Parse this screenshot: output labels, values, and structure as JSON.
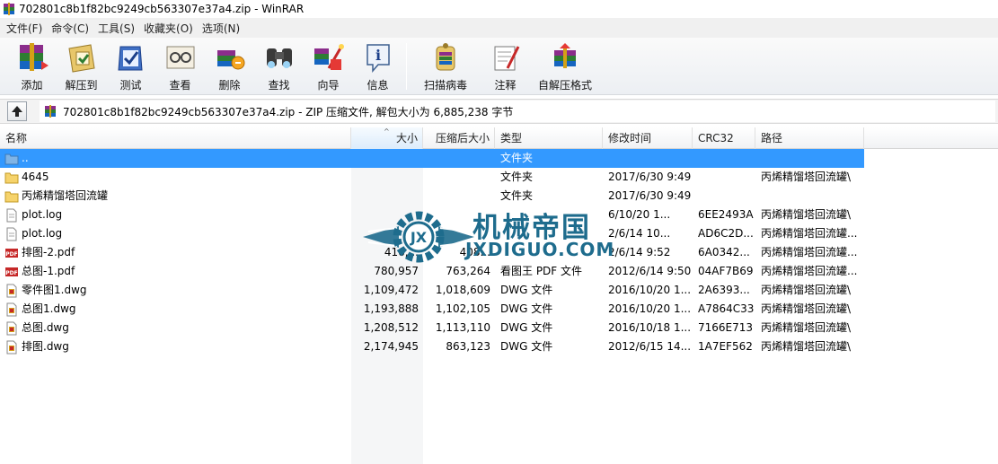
{
  "window": {
    "title": "702801c8b1f82bc9249cb563307e37a4.zip - WinRAR"
  },
  "menu": [
    {
      "label": "文件(F)"
    },
    {
      "label": "命令(C)"
    },
    {
      "label": "工具(S)"
    },
    {
      "label": "收藏夹(O)"
    },
    {
      "label": "选项(N)"
    }
  ],
  "toolbar": [
    {
      "label": "添加",
      "icon": "add-icon"
    },
    {
      "label": "解压到",
      "icon": "extract-to-icon"
    },
    {
      "label": "测试",
      "icon": "test-icon"
    },
    {
      "label": "查看",
      "icon": "view-icon"
    },
    {
      "label": "删除",
      "icon": "delete-icon"
    },
    {
      "label": "查找",
      "icon": "find-icon"
    },
    {
      "label": "向导",
      "icon": "wizard-icon"
    },
    {
      "label": "信息",
      "icon": "info-icon"
    },
    {
      "label": "扫描病毒",
      "icon": "virus-scan-icon"
    },
    {
      "label": "注释",
      "icon": "comment-icon"
    },
    {
      "label": "自解压格式",
      "icon": "sfx-icon"
    }
  ],
  "pathbar": {
    "path": "702801c8b1f82bc9249cb563307e37a4.zip - ZIP 压缩文件, 解包大小为 6,885,238 字节"
  },
  "columns": {
    "name": "名称",
    "size": "大小",
    "packed": "压缩后大小",
    "type": "类型",
    "modified": "修改时间",
    "crc": "CRC32",
    "path": "路径"
  },
  "files": [
    {
      "name": "..",
      "size": "",
      "packed": "",
      "type": "文件夹",
      "modified": "",
      "crc": "",
      "path": "",
      "icon": "folder-up-icon",
      "selected": true
    },
    {
      "name": "4645",
      "size": "",
      "packed": "",
      "type": "文件夹",
      "modified": "2017/6/30 9:49",
      "crc": "",
      "path": "丙烯精馏塔回流罐\\",
      "icon": "folder-icon"
    },
    {
      "name": "丙烯精馏塔回流罐",
      "size": "",
      "packed": "",
      "type": "文件夹",
      "modified": "2017/6/30 9:49",
      "crc": "",
      "path": "",
      "icon": "folder-icon"
    },
    {
      "name": "plot.log",
      "size": "",
      "packed": "",
      "type": "",
      "modified": "6/10/20 1...",
      "crc": "6EE2493A",
      "path": "丙烯精馏塔回流罐\\",
      "icon": "text-file-icon"
    },
    {
      "name": "plot.log",
      "size": "",
      "packed": "",
      "type": "",
      "modified": "2/6/14 10...",
      "crc": "AD6C2D...",
      "path": "丙烯精馏塔回流罐...",
      "icon": "text-file-icon"
    },
    {
      "name": "排图-2.pdf",
      "size": "416,...",
      "packed": "408...",
      "type": "",
      "modified": "2/6/14 9:52",
      "crc": "6A0342...",
      "path": "丙烯精馏塔回流罐...",
      "icon": "pdf-icon"
    },
    {
      "name": "总图-1.pdf",
      "size": "780,957",
      "packed": "763,264",
      "type": "看图王 PDF 文件",
      "modified": "2012/6/14 9:50",
      "crc": "04AF7B69",
      "path": "丙烯精馏塔回流罐...",
      "icon": "pdf-icon"
    },
    {
      "name": "零件图1.dwg",
      "size": "1,109,472",
      "packed": "1,018,609",
      "type": "DWG 文件",
      "modified": "2016/10/20 1...",
      "crc": "2A6393...",
      "path": "丙烯精馏塔回流罐\\",
      "icon": "dwg-icon"
    },
    {
      "name": "总图1.dwg",
      "size": "1,193,888",
      "packed": "1,102,105",
      "type": "DWG 文件",
      "modified": "2016/10/20 1...",
      "crc": "A7864C33",
      "path": "丙烯精馏塔回流罐\\",
      "icon": "dwg-icon"
    },
    {
      "name": "总图.dwg",
      "size": "1,208,512",
      "packed": "1,113,110",
      "type": "DWG 文件",
      "modified": "2016/10/18 1...",
      "crc": "7166E713",
      "path": "丙烯精馏塔回流罐\\",
      "icon": "dwg-icon"
    },
    {
      "name": "排图.dwg",
      "size": "2,174,945",
      "packed": "863,123",
      "type": "DWG 文件",
      "modified": "2012/6/15 14...",
      "crc": "1A7EF562",
      "path": "丙烯精馏塔回流罐\\",
      "icon": "dwg-icon"
    }
  ],
  "watermark": {
    "title": "机械帝国",
    "subtitle": "JXDIGUO.COM"
  },
  "colors": {
    "selection": "#3399ff",
    "watermark": "#1e6c8d"
  }
}
